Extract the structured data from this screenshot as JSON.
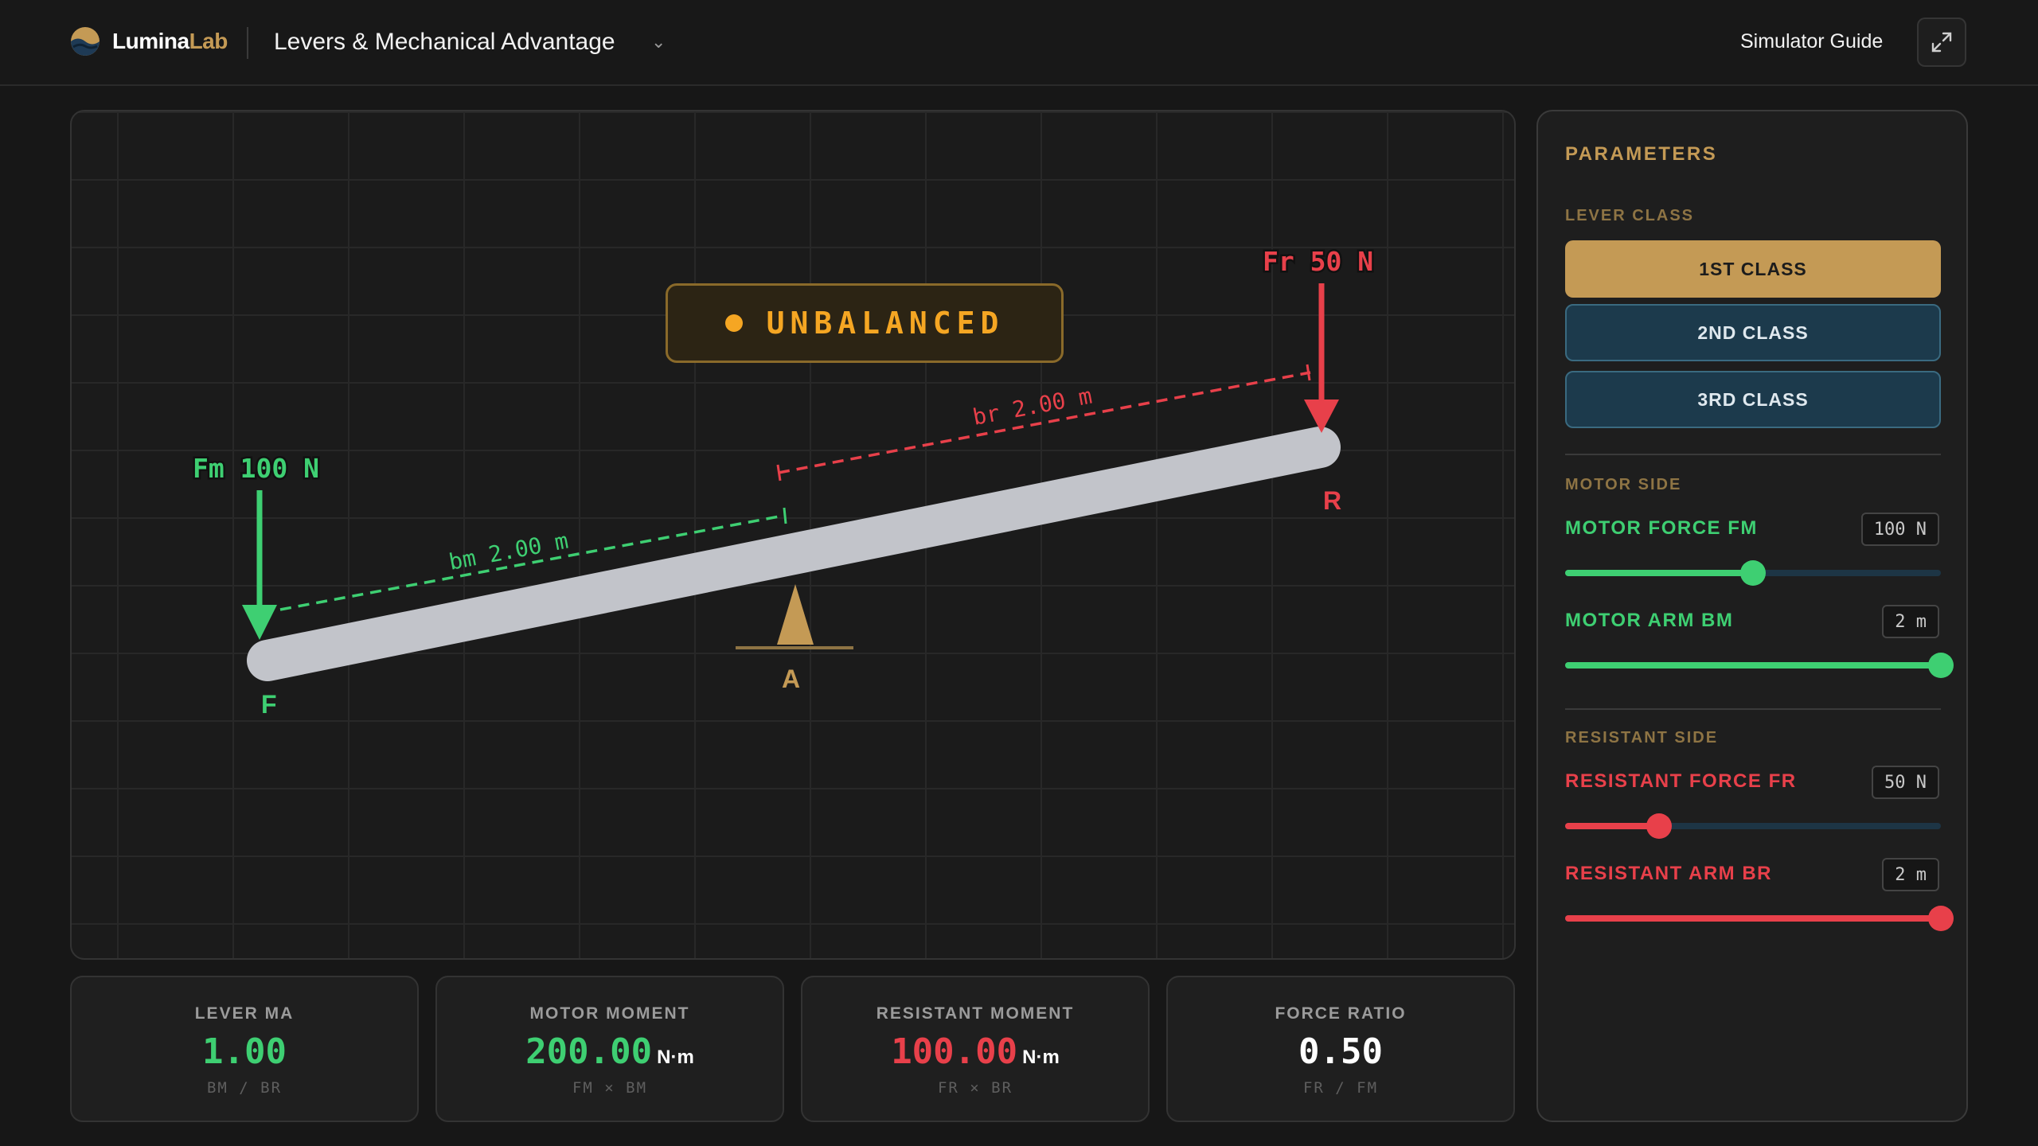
{
  "header": {
    "brand_white": "Lumina",
    "brand_gold": "Lab",
    "simulator_title": "Levers & Mechanical Advantage",
    "guide_label": "Simulator Guide"
  },
  "canvas": {
    "status": "UNBALANCED",
    "motor_force_label": "Fm 100 N",
    "resistant_force_label": "Fr 50 N",
    "motor_arm_label": "bm 2.00 m",
    "resistant_arm_label": "br 2.00 m",
    "point_motor": "F",
    "point_resistant": "R",
    "point_fulcrum": "A"
  },
  "stats": [
    {
      "label": "LEVER MA",
      "value": "1.00",
      "unit": "",
      "formula": "BM / BR",
      "color": "#3ecf72"
    },
    {
      "label": "MOTOR MOMENT",
      "value": "200.00",
      "unit": "N·m",
      "formula": "FM × BM",
      "color": "#3ecf72"
    },
    {
      "label": "RESISTANT MOMENT",
      "value": "100.00",
      "unit": "N·m",
      "formula": "FR × BR",
      "color": "#e8404a"
    },
    {
      "label": "FORCE RATIO",
      "value": "0.50",
      "unit": "",
      "formula": "FR / FM",
      "color": "#ffffff"
    }
  ],
  "panel": {
    "title": "PARAMETERS",
    "lever_class_label": "LEVER CLASS",
    "class_buttons": [
      "1ST CLASS",
      "2ND CLASS",
      "3RD CLASS"
    ],
    "active_class_index": 0,
    "motor_side_label": "MOTOR SIDE",
    "resistant_side_label": "RESISTANT SIDE",
    "params": {
      "motor_force": {
        "label": "MOTOR FORCE FM",
        "display": "100 N",
        "fraction": 0.5
      },
      "motor_arm": {
        "label": "MOTOR ARM BM",
        "display": "2 m",
        "fraction": 1.0
      },
      "resistant_force": {
        "label": "RESISTANT FORCE FR",
        "display": "50 N",
        "fraction": 0.25
      },
      "resistant_arm": {
        "label": "RESISTANT ARM BR",
        "display": "2 m",
        "fraction": 1.0
      }
    }
  },
  "colors": {
    "motor": "#3ecf72",
    "resistant": "#e8404a",
    "accent": "#c49a55",
    "status": "#f5a623"
  }
}
